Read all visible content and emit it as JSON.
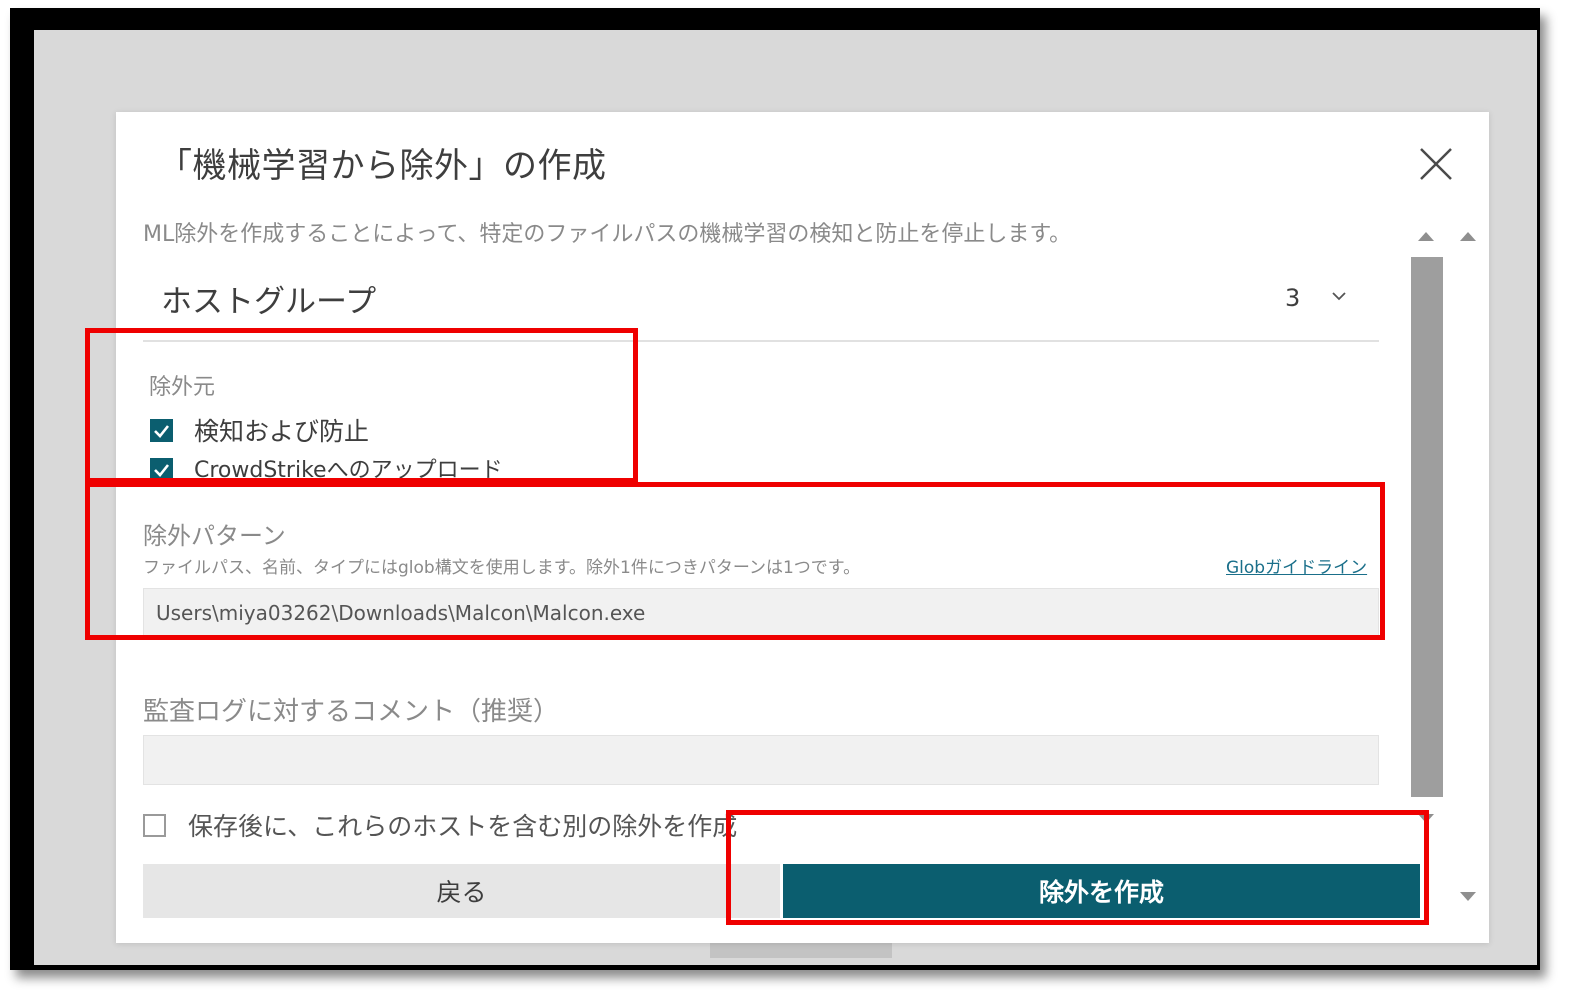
{
  "dialog": {
    "title": "「機械学習から除外」の作成",
    "description": "ML除外を作成することによって、特定のファイルパスの機械学習の検知と防止を停止します。",
    "close_icon": "close-icon"
  },
  "host_group": {
    "label": "ホストグループ",
    "count": "3",
    "chevron_icon": "chevron-down-icon"
  },
  "exclude_from": {
    "label": "除外元",
    "options": [
      {
        "label": "検知および防止",
        "checked": true
      },
      {
        "label": "CrowdStrikeへのアップロード",
        "checked": true
      }
    ]
  },
  "pattern": {
    "label": "除外パターン",
    "help": "ファイルパス、名前、タイプにはglob構文を使用します。除外1件につきパターンは1つです。",
    "guide_link": "Globガイドライン",
    "value": "Users\\miya03262\\Downloads\\Malcon\\Malcon.exe"
  },
  "comment": {
    "label": "監査ログに対するコメント（推奨）",
    "value": ""
  },
  "save_another": {
    "label": "保存後に、これらのホストを含む別の除外を作成",
    "checked": false
  },
  "buttons": {
    "back": "戻る",
    "create": "除外を作成"
  },
  "colors": {
    "primary": "#0b5e6f",
    "highlight": "#ef0000",
    "link": "#1a6f8a"
  }
}
